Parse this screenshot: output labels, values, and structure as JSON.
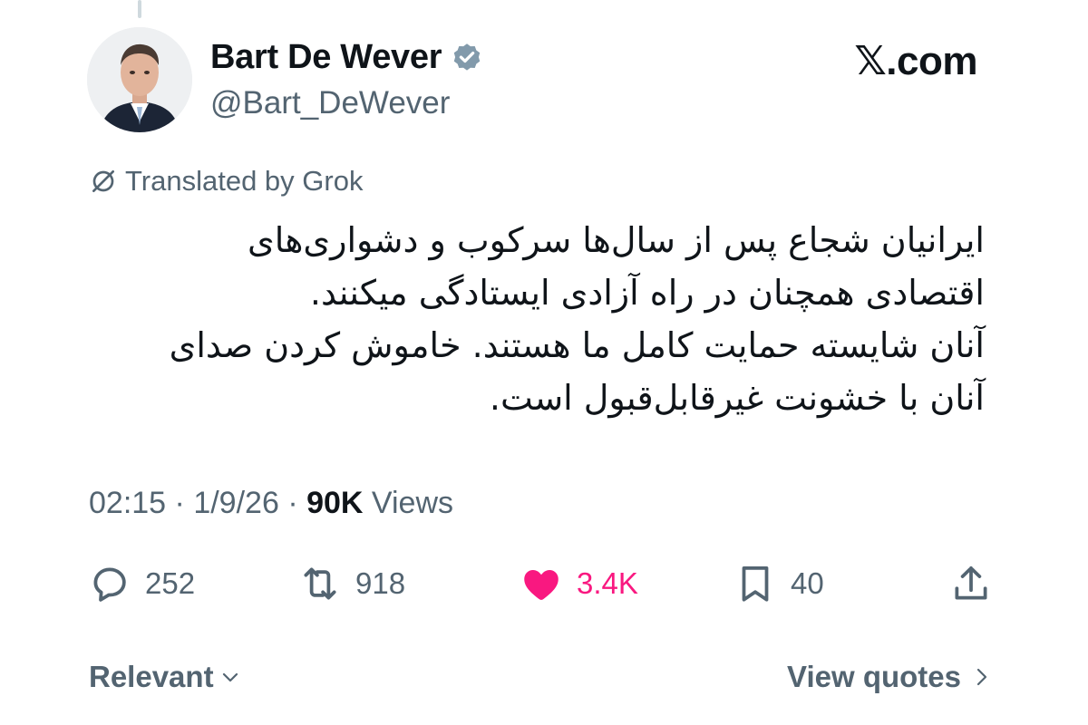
{
  "author": {
    "name": "Bart De Wever",
    "handle": "@Bart_DeWever",
    "verified": true
  },
  "brand": "𝕏.com",
  "translation": {
    "label": "Translated by Grok"
  },
  "tweet": {
    "lines": [
      "ایرانیان شجاع پس از سال‌ها سرکوب و دشواری‌های",
      "اقتصادی همچنان در راه آزادی ایستادگی میکنند.",
      "آنان شایسته حمایت کامل ما هستند. خاموش کردن صدای",
      "آنان با خشونت غیرقابل‌قبول است."
    ]
  },
  "meta": {
    "time": "02:15",
    "date": "1/9/26",
    "views_count": "90K",
    "views_label": "Views",
    "separator": "·"
  },
  "actions": {
    "replies": "252",
    "reposts": "918",
    "likes": "3.4K",
    "bookmarks": "40"
  },
  "footer": {
    "sort_label": "Relevant",
    "view_quotes_label": "View quotes"
  },
  "colors": {
    "accent_like": "#f91880",
    "muted": "#536471",
    "text": "#0f1419",
    "verified": "#829aab"
  }
}
